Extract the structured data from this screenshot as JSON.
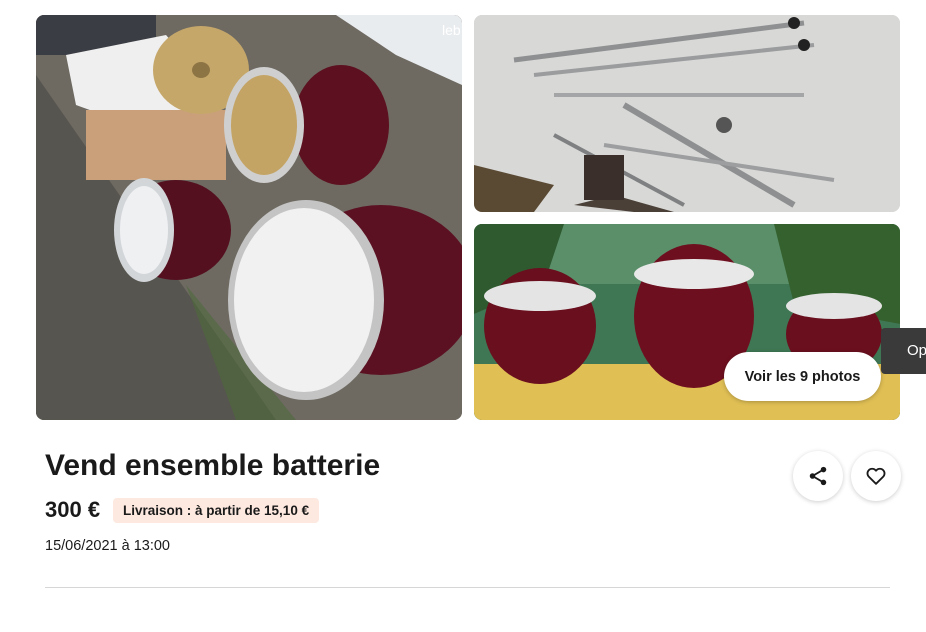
{
  "listing": {
    "title": "Vend ensemble batterie",
    "price": "300 €",
    "delivery": "Livraison : à partir de 15,10 €",
    "date": "15/06/2021 à 13:00"
  },
  "gallery": {
    "see_all_label": "Voir les 9 photos",
    "watermark": "leb"
  },
  "side_tab": {
    "label": "Op"
  },
  "icons": {
    "share": "share-icon",
    "favorite": "heart-icon"
  },
  "colors": {
    "badge_background": "#fde9e0",
    "text": "#1a1a1a",
    "drum_shell": "#6b1220",
    "side_tab": "#3a3a3a"
  }
}
